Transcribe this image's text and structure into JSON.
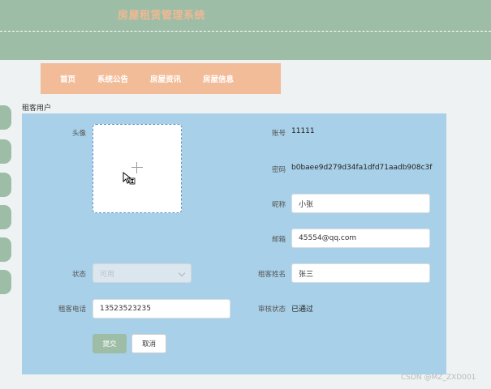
{
  "app": {
    "title": "房屋租赁管理系统"
  },
  "nav": {
    "items": [
      "首页",
      "系统公告",
      "房屋资讯",
      "房屋信息"
    ]
  },
  "page": {
    "title": "租客用户"
  },
  "form": {
    "avatar_label": "头像",
    "account_label": "账号",
    "account_value": "11111",
    "password_label": "密码",
    "password_value": "b0baee9d279d34fa1dfd71aadb908c3f",
    "nickname_label": "昵称",
    "nickname_value": "小张",
    "email_label": "邮箱",
    "email_value": "45554@qq.com",
    "status_label": "状态",
    "status_value": "可用",
    "tenant_name_label": "租客姓名",
    "tenant_name_value": "张三",
    "phone_label": "租客电话",
    "phone_value": "13523523235",
    "review_label": "审核状态",
    "review_value": "已通过",
    "submit_label": "提交",
    "cancel_label": "取消"
  },
  "watermark": "CSDN @MZ_ZXD001",
  "colors": {
    "header": "#9dbda6",
    "nav": "#f3bc98",
    "title": "#f1b993",
    "panel": "#a8d0e8",
    "side_tab": "#9dbda6"
  }
}
